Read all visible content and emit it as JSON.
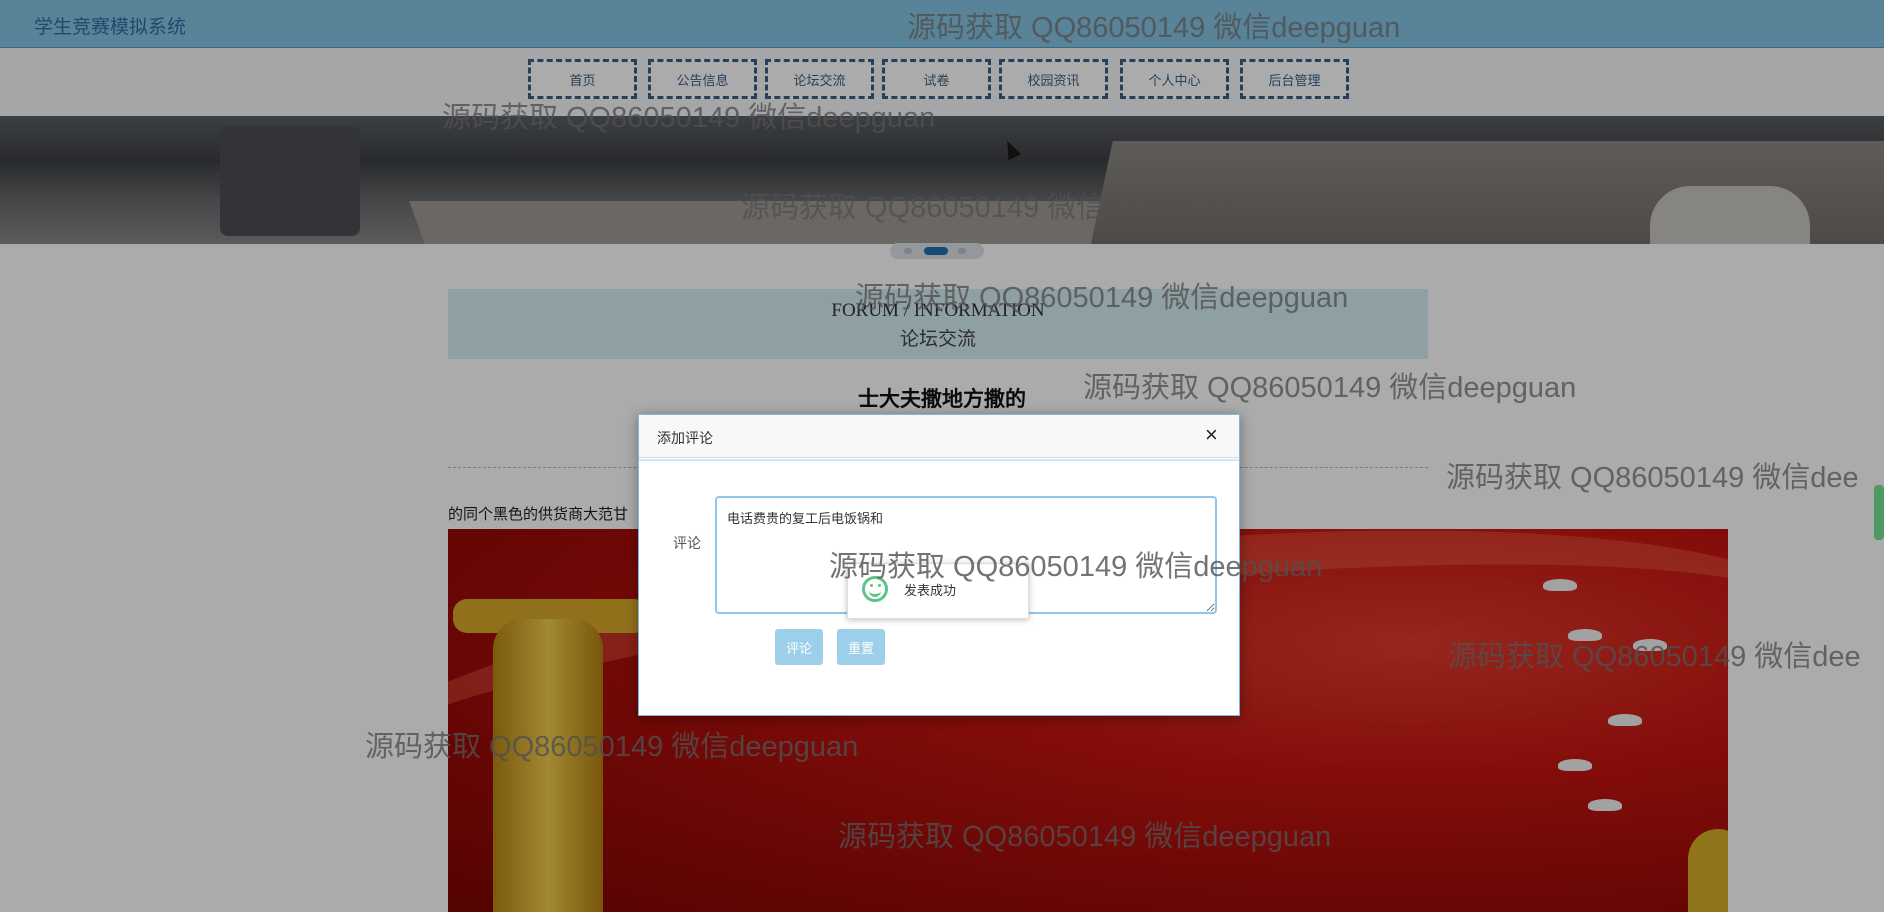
{
  "app": {
    "title": "学生竞赛模拟系统"
  },
  "nav": {
    "items": [
      "首页",
      "公告信息",
      "论坛交流",
      "试卷",
      "校园资讯",
      "个人中心",
      "后台管理"
    ]
  },
  "section": {
    "en_title": "FORUM / INFORMATION",
    "cn_title": "论坛交流"
  },
  "post": {
    "title": "士大夫撒地方撒的",
    "body": "的同个黑色的供货商大范甘"
  },
  "modal": {
    "title": "添加评论",
    "close": "×",
    "comment_label": "评论",
    "comment_value": "电话费贵的复工后电饭锅和",
    "submit_label": "评论",
    "reset_label": "重置"
  },
  "toast": {
    "message": "发表成功"
  },
  "watermark": {
    "text": "源码获取 QQ86050149 微信deepguan",
    "truncated": "源码获取 QQ86050149 微信dee"
  },
  "colors": {
    "topbar": "#85c4e3",
    "nav_border": "#3a5f86",
    "button": "#9cd0ea",
    "section_bg": "#d4eff5"
  }
}
